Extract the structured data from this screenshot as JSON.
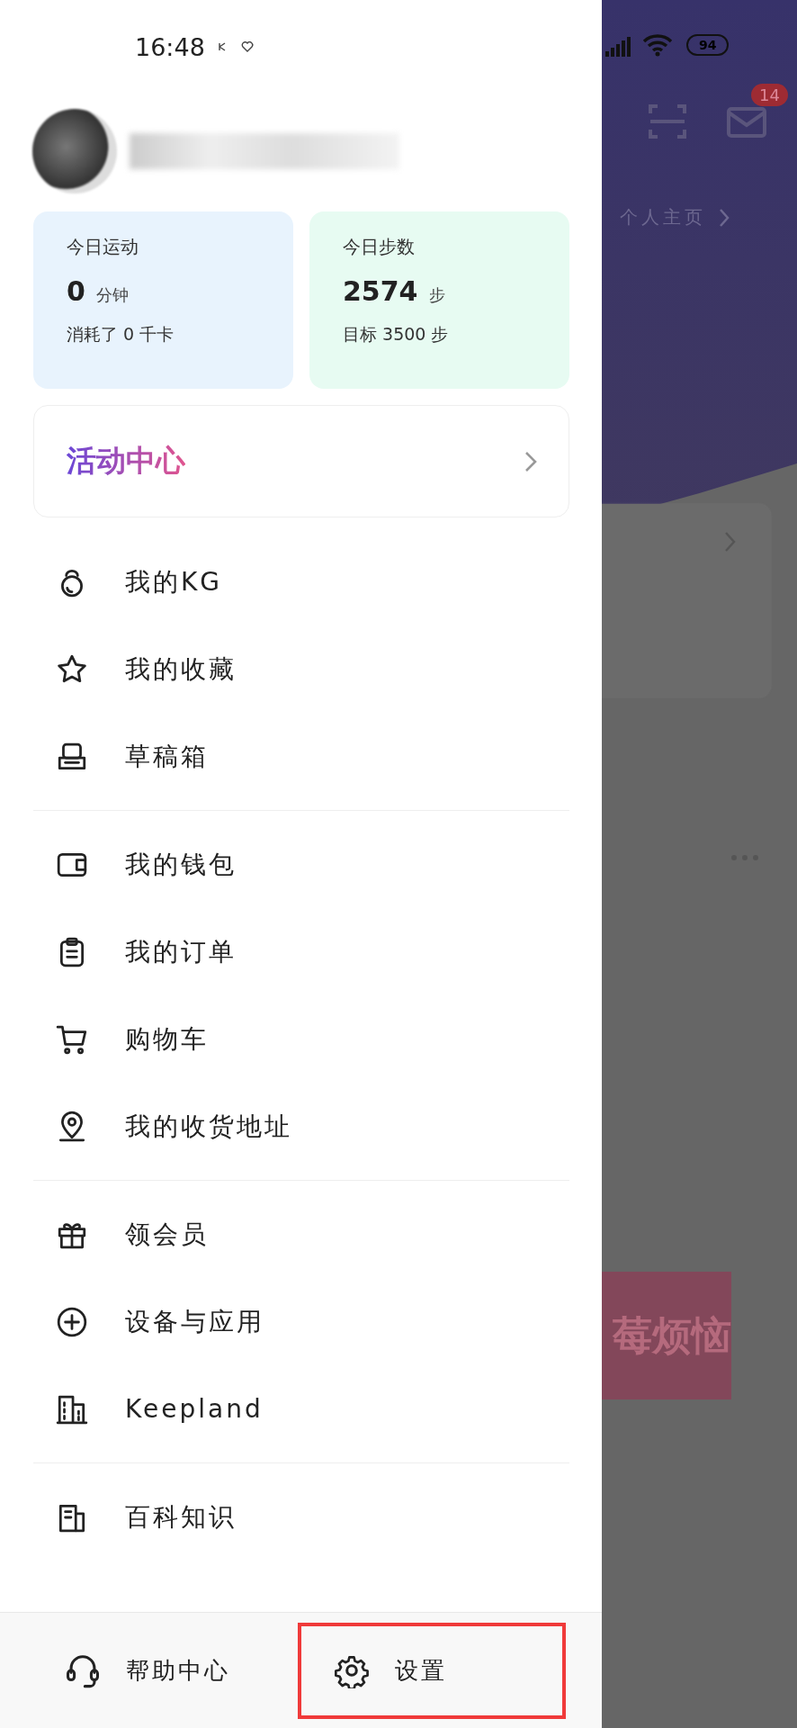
{
  "status_bar": {
    "time": "16:48",
    "battery": "94"
  },
  "background": {
    "badge": "14",
    "profile_link": "个人主页",
    "banner": "莓烦恼"
  },
  "stats": [
    {
      "title": "今日运动",
      "value": "0",
      "unit": "分钟",
      "note": "消耗了 0 千卡",
      "color": "#e8f3fd"
    },
    {
      "title": "今日步数",
      "value": "2574",
      "unit": "步",
      "note": "目标 3500 步",
      "color": "#e7fbf2"
    }
  ],
  "activity_center": {
    "label": "活动中心"
  },
  "menu_groups": [
    [
      {
        "label": "我的KG",
        "kind": "kettlebell"
      },
      {
        "label": "我的收藏",
        "kind": "star"
      },
      {
        "label": "草稿箱",
        "kind": "tray"
      }
    ],
    [
      {
        "label": "我的钱包",
        "kind": "wallet"
      },
      {
        "label": "我的订单",
        "kind": "clipboard"
      },
      {
        "label": "购物车",
        "kind": "cart"
      },
      {
        "label": "我的收货地址",
        "kind": "pin"
      }
    ],
    [
      {
        "label": "领会员",
        "kind": "gift"
      },
      {
        "label": "设备与应用",
        "kind": "plus"
      },
      {
        "label": "Keepland",
        "kind": "building"
      }
    ],
    [
      {
        "label": "百科知识",
        "kind": "book"
      }
    ]
  ],
  "bottom_bar": [
    {
      "label": "帮助中心",
      "kind": "headset",
      "highlighted": false
    },
    {
      "label": "设置",
      "kind": "gear",
      "highlighted": true
    }
  ]
}
